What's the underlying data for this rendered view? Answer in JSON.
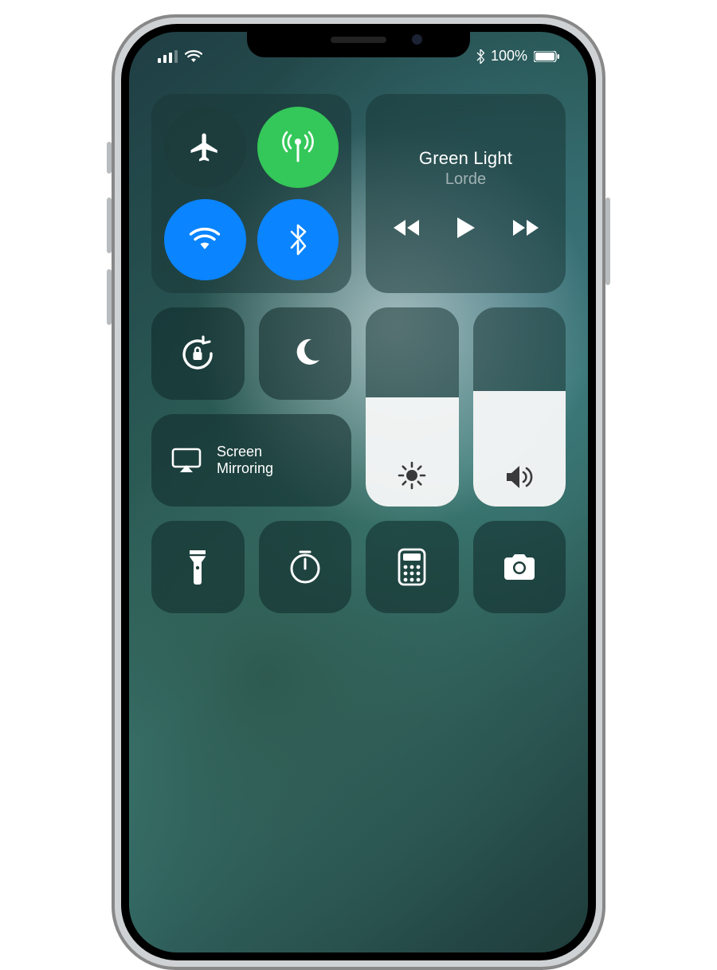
{
  "status": {
    "battery_text": "100%"
  },
  "connectivity": {
    "airplane": {
      "active": false
    },
    "cellular": {
      "active": true,
      "color": "#34c759"
    },
    "wifi": {
      "active": true,
      "color": "#0a84ff"
    },
    "bluetooth": {
      "active": true,
      "color": "#0a84ff"
    }
  },
  "media": {
    "title": "Green Light",
    "artist": "Lorde",
    "state": "paused"
  },
  "sliders": {
    "brightness_pct": 55,
    "volume_pct": 58
  },
  "mirroring": {
    "line1": "Screen",
    "line2": "Mirroring"
  },
  "toggles": {
    "orientation_lock": {
      "active": false
    },
    "do_not_disturb": {
      "active": false
    }
  },
  "shortcuts": {
    "flashlight": {},
    "timer": {},
    "calculator": {},
    "camera": {}
  }
}
